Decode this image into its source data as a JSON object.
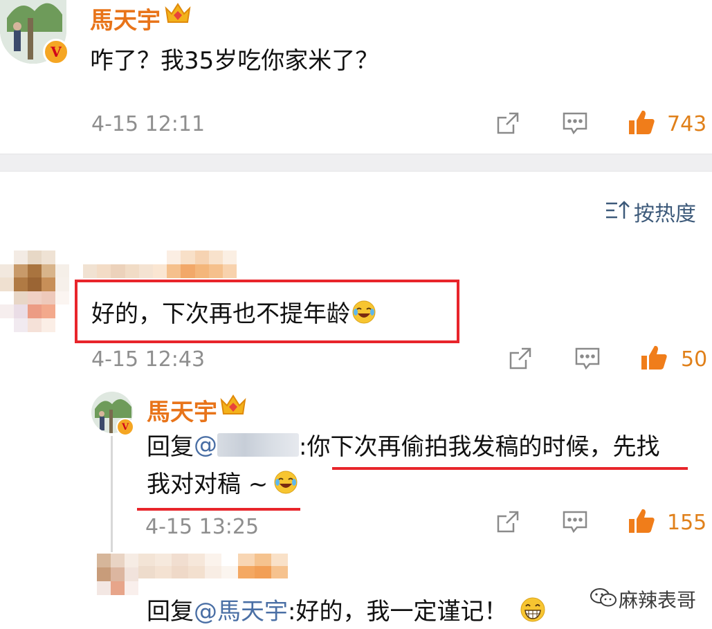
{
  "comments": [
    {
      "username": "馬天宇",
      "text": "咋了？我35岁吃你家米了？",
      "timestamp": "4-15 12:11",
      "likes": "743"
    },
    {
      "username": "",
      "text": "好的，下次再也不提年龄",
      "timestamp": "4-15 12:43",
      "likes": "50",
      "replies": [
        {
          "username": "馬天宇",
          "reply_prefix": "回复",
          "mention": "@",
          "text_line1": ":你下次再偷拍我发稿的时候，先找",
          "text_line2": "我对对稿 ~",
          "timestamp": "4-15 13:25",
          "likes": "155"
        },
        {
          "username": "",
          "reply_prefix": "回复",
          "mention": "@馬天宇",
          "text": ":好的，我一定谨记！"
        }
      ]
    }
  ],
  "sort_label": "按热度",
  "watermark": "麻辣表哥",
  "icons": [
    "crown-icon",
    "v-verified-icon",
    "share-icon",
    "comment-icon",
    "like-icon",
    "sort-icon",
    "laugh-cry-emoji",
    "grin-emoji",
    "wechat-icon"
  ],
  "colors": {
    "username": "#e8741a",
    "like": "#e0801a",
    "highlight": "#e8252b",
    "mention": "#4a6fa5"
  }
}
